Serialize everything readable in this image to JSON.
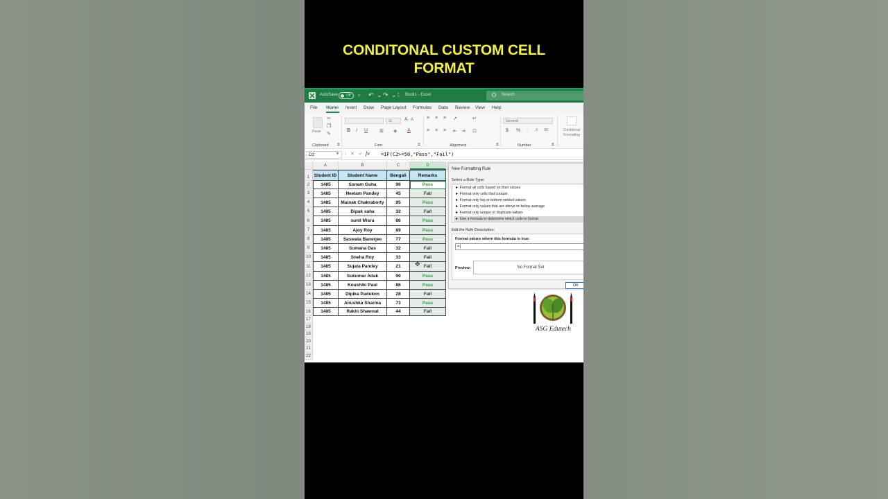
{
  "video": {
    "title_line1": "CONDITONAL CUSTOM CELL",
    "title_line2": "FORMAT"
  },
  "titlebar": {
    "autosave": "AutoSave",
    "autosave_state": "Off",
    "book": "Book1 - Excel",
    "search_placeholder": "Search"
  },
  "menu": [
    "File",
    "Home",
    "Insert",
    "Draw",
    "Page Layout",
    "Formulas",
    "Data",
    "Review",
    "View",
    "Help"
  ],
  "ribbon": {
    "groups": {
      "clipboard": "Clipboard",
      "font": "Font",
      "alignment": "Alignment",
      "number": "Number"
    },
    "paste": "Paste",
    "font_size": "11",
    "number_format": "General",
    "conditional_formatting": "Conditional Formatting",
    "bold": "B",
    "italic": "I",
    "underline": "U"
  },
  "formula_bar": {
    "cell": "D2",
    "fx": "fx",
    "formula": "=IF(C2>=50,\"Pass\",\"Fail\")"
  },
  "sheet": {
    "columns": [
      "A",
      "B",
      "C",
      "D"
    ],
    "row_numbers": [
      "1",
      "2",
      "3",
      "4",
      "5",
      "6",
      "7",
      "8",
      "9",
      "10",
      "11",
      "12",
      "13",
      "14",
      "15",
      "16",
      "17",
      "18",
      "19",
      "20",
      "21",
      "22"
    ],
    "headers": [
      "Student ID",
      "Student Name",
      "Bengali",
      "Remarks"
    ],
    "rows": [
      [
        "1485",
        "Sonam Guha",
        "96",
        "Pass"
      ],
      [
        "1485",
        "Neelam Pandey",
        "45",
        "Fail"
      ],
      [
        "1485",
        "Mainak Chakraborty",
        "95",
        "Pass"
      ],
      [
        "1485",
        "Dipak saha",
        "32",
        "Fail"
      ],
      [
        "1485",
        "sunil Misra",
        "86",
        "Pass"
      ],
      [
        "1485",
        "Ajoy Roy",
        "89",
        "Pass"
      ],
      [
        "1485",
        "Saswata Banerjee",
        "77",
        "Pass"
      ],
      [
        "1485",
        "Sumana Das",
        "32",
        "Fail"
      ],
      [
        "1485",
        "Sneha Roy",
        "33",
        "Fail"
      ],
      [
        "1485",
        "Sujata Pandey",
        "21",
        "Fail"
      ],
      [
        "1485",
        "Sukumar Adak",
        "99",
        "Pass"
      ],
      [
        "1485",
        "Koushiki Paul",
        "86",
        "Pass"
      ],
      [
        "1485",
        "Dipika Padukon",
        "28",
        "Fail"
      ],
      [
        "1485",
        "Anushka Sharma",
        "73",
        "Pass"
      ],
      [
        "1485",
        "Rakhi Shawnat",
        "44",
        "Fail"
      ]
    ]
  },
  "dialog": {
    "title": "New Formatting Rule",
    "select_label": "Select a Rule Type:",
    "rule_types": [
      "► Format all cells based on their values",
      "► Format only cells that contain",
      "► Format only top or bottom ranked values",
      "► Format only values that are above or below average",
      "► Format only unique or duplicate values",
      "► Use a formula to determine which cells to format"
    ],
    "selected_rule_index": 5,
    "edit_label": "Edit the Rule Description:",
    "formula_label": "Format values where this formula is true:",
    "formula_value": "=|",
    "preview_label": "Preview:",
    "preview_text": "No Format Set",
    "ok": "OK"
  },
  "logo": {
    "text": "ASG Edutech"
  },
  "colors": {
    "excel_green": "#1f7a43",
    "title_yellow": "#f2f046",
    "header_fill": "#c5e5f5",
    "pass_green": "#2e9e3e"
  }
}
